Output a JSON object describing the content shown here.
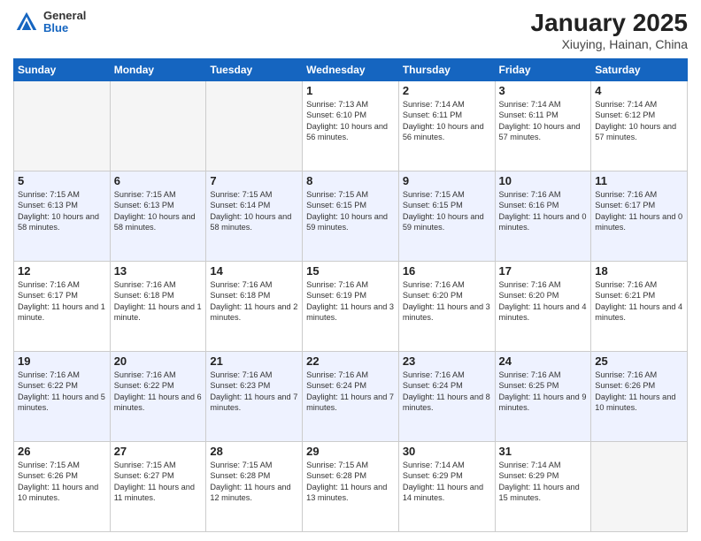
{
  "header": {
    "logo_general": "General",
    "logo_blue": "Blue",
    "title": "January 2025",
    "location": "Xiuying, Hainan, China"
  },
  "days_of_week": [
    "Sunday",
    "Monday",
    "Tuesday",
    "Wednesday",
    "Thursday",
    "Friday",
    "Saturday"
  ],
  "weeks": [
    [
      {
        "day": "",
        "info": ""
      },
      {
        "day": "",
        "info": ""
      },
      {
        "day": "",
        "info": ""
      },
      {
        "day": "1",
        "info": "Sunrise: 7:13 AM\nSunset: 6:10 PM\nDaylight: 10 hours and 56 minutes."
      },
      {
        "day": "2",
        "info": "Sunrise: 7:14 AM\nSunset: 6:11 PM\nDaylight: 10 hours and 56 minutes."
      },
      {
        "day": "3",
        "info": "Sunrise: 7:14 AM\nSunset: 6:11 PM\nDaylight: 10 hours and 57 minutes."
      },
      {
        "day": "4",
        "info": "Sunrise: 7:14 AM\nSunset: 6:12 PM\nDaylight: 10 hours and 57 minutes."
      }
    ],
    [
      {
        "day": "5",
        "info": "Sunrise: 7:15 AM\nSunset: 6:13 PM\nDaylight: 10 hours and 58 minutes."
      },
      {
        "day": "6",
        "info": "Sunrise: 7:15 AM\nSunset: 6:13 PM\nDaylight: 10 hours and 58 minutes."
      },
      {
        "day": "7",
        "info": "Sunrise: 7:15 AM\nSunset: 6:14 PM\nDaylight: 10 hours and 58 minutes."
      },
      {
        "day": "8",
        "info": "Sunrise: 7:15 AM\nSunset: 6:15 PM\nDaylight: 10 hours and 59 minutes."
      },
      {
        "day": "9",
        "info": "Sunrise: 7:15 AM\nSunset: 6:15 PM\nDaylight: 10 hours and 59 minutes."
      },
      {
        "day": "10",
        "info": "Sunrise: 7:16 AM\nSunset: 6:16 PM\nDaylight: 11 hours and 0 minutes."
      },
      {
        "day": "11",
        "info": "Sunrise: 7:16 AM\nSunset: 6:17 PM\nDaylight: 11 hours and 0 minutes."
      }
    ],
    [
      {
        "day": "12",
        "info": "Sunrise: 7:16 AM\nSunset: 6:17 PM\nDaylight: 11 hours and 1 minute."
      },
      {
        "day": "13",
        "info": "Sunrise: 7:16 AM\nSunset: 6:18 PM\nDaylight: 11 hours and 1 minute."
      },
      {
        "day": "14",
        "info": "Sunrise: 7:16 AM\nSunset: 6:18 PM\nDaylight: 11 hours and 2 minutes."
      },
      {
        "day": "15",
        "info": "Sunrise: 7:16 AM\nSunset: 6:19 PM\nDaylight: 11 hours and 3 minutes."
      },
      {
        "day": "16",
        "info": "Sunrise: 7:16 AM\nSunset: 6:20 PM\nDaylight: 11 hours and 3 minutes."
      },
      {
        "day": "17",
        "info": "Sunrise: 7:16 AM\nSunset: 6:20 PM\nDaylight: 11 hours and 4 minutes."
      },
      {
        "day": "18",
        "info": "Sunrise: 7:16 AM\nSunset: 6:21 PM\nDaylight: 11 hours and 4 minutes."
      }
    ],
    [
      {
        "day": "19",
        "info": "Sunrise: 7:16 AM\nSunset: 6:22 PM\nDaylight: 11 hours and 5 minutes."
      },
      {
        "day": "20",
        "info": "Sunrise: 7:16 AM\nSunset: 6:22 PM\nDaylight: 11 hours and 6 minutes."
      },
      {
        "day": "21",
        "info": "Sunrise: 7:16 AM\nSunset: 6:23 PM\nDaylight: 11 hours and 7 minutes."
      },
      {
        "day": "22",
        "info": "Sunrise: 7:16 AM\nSunset: 6:24 PM\nDaylight: 11 hours and 7 minutes."
      },
      {
        "day": "23",
        "info": "Sunrise: 7:16 AM\nSunset: 6:24 PM\nDaylight: 11 hours and 8 minutes."
      },
      {
        "day": "24",
        "info": "Sunrise: 7:16 AM\nSunset: 6:25 PM\nDaylight: 11 hours and 9 minutes."
      },
      {
        "day": "25",
        "info": "Sunrise: 7:16 AM\nSunset: 6:26 PM\nDaylight: 11 hours and 10 minutes."
      }
    ],
    [
      {
        "day": "26",
        "info": "Sunrise: 7:15 AM\nSunset: 6:26 PM\nDaylight: 11 hours and 10 minutes."
      },
      {
        "day": "27",
        "info": "Sunrise: 7:15 AM\nSunset: 6:27 PM\nDaylight: 11 hours and 11 minutes."
      },
      {
        "day": "28",
        "info": "Sunrise: 7:15 AM\nSunset: 6:28 PM\nDaylight: 11 hours and 12 minutes."
      },
      {
        "day": "29",
        "info": "Sunrise: 7:15 AM\nSunset: 6:28 PM\nDaylight: 11 hours and 13 minutes."
      },
      {
        "day": "30",
        "info": "Sunrise: 7:14 AM\nSunset: 6:29 PM\nDaylight: 11 hours and 14 minutes."
      },
      {
        "day": "31",
        "info": "Sunrise: 7:14 AM\nSunset: 6:29 PM\nDaylight: 11 hours and 15 minutes."
      },
      {
        "day": "",
        "info": ""
      }
    ]
  ]
}
